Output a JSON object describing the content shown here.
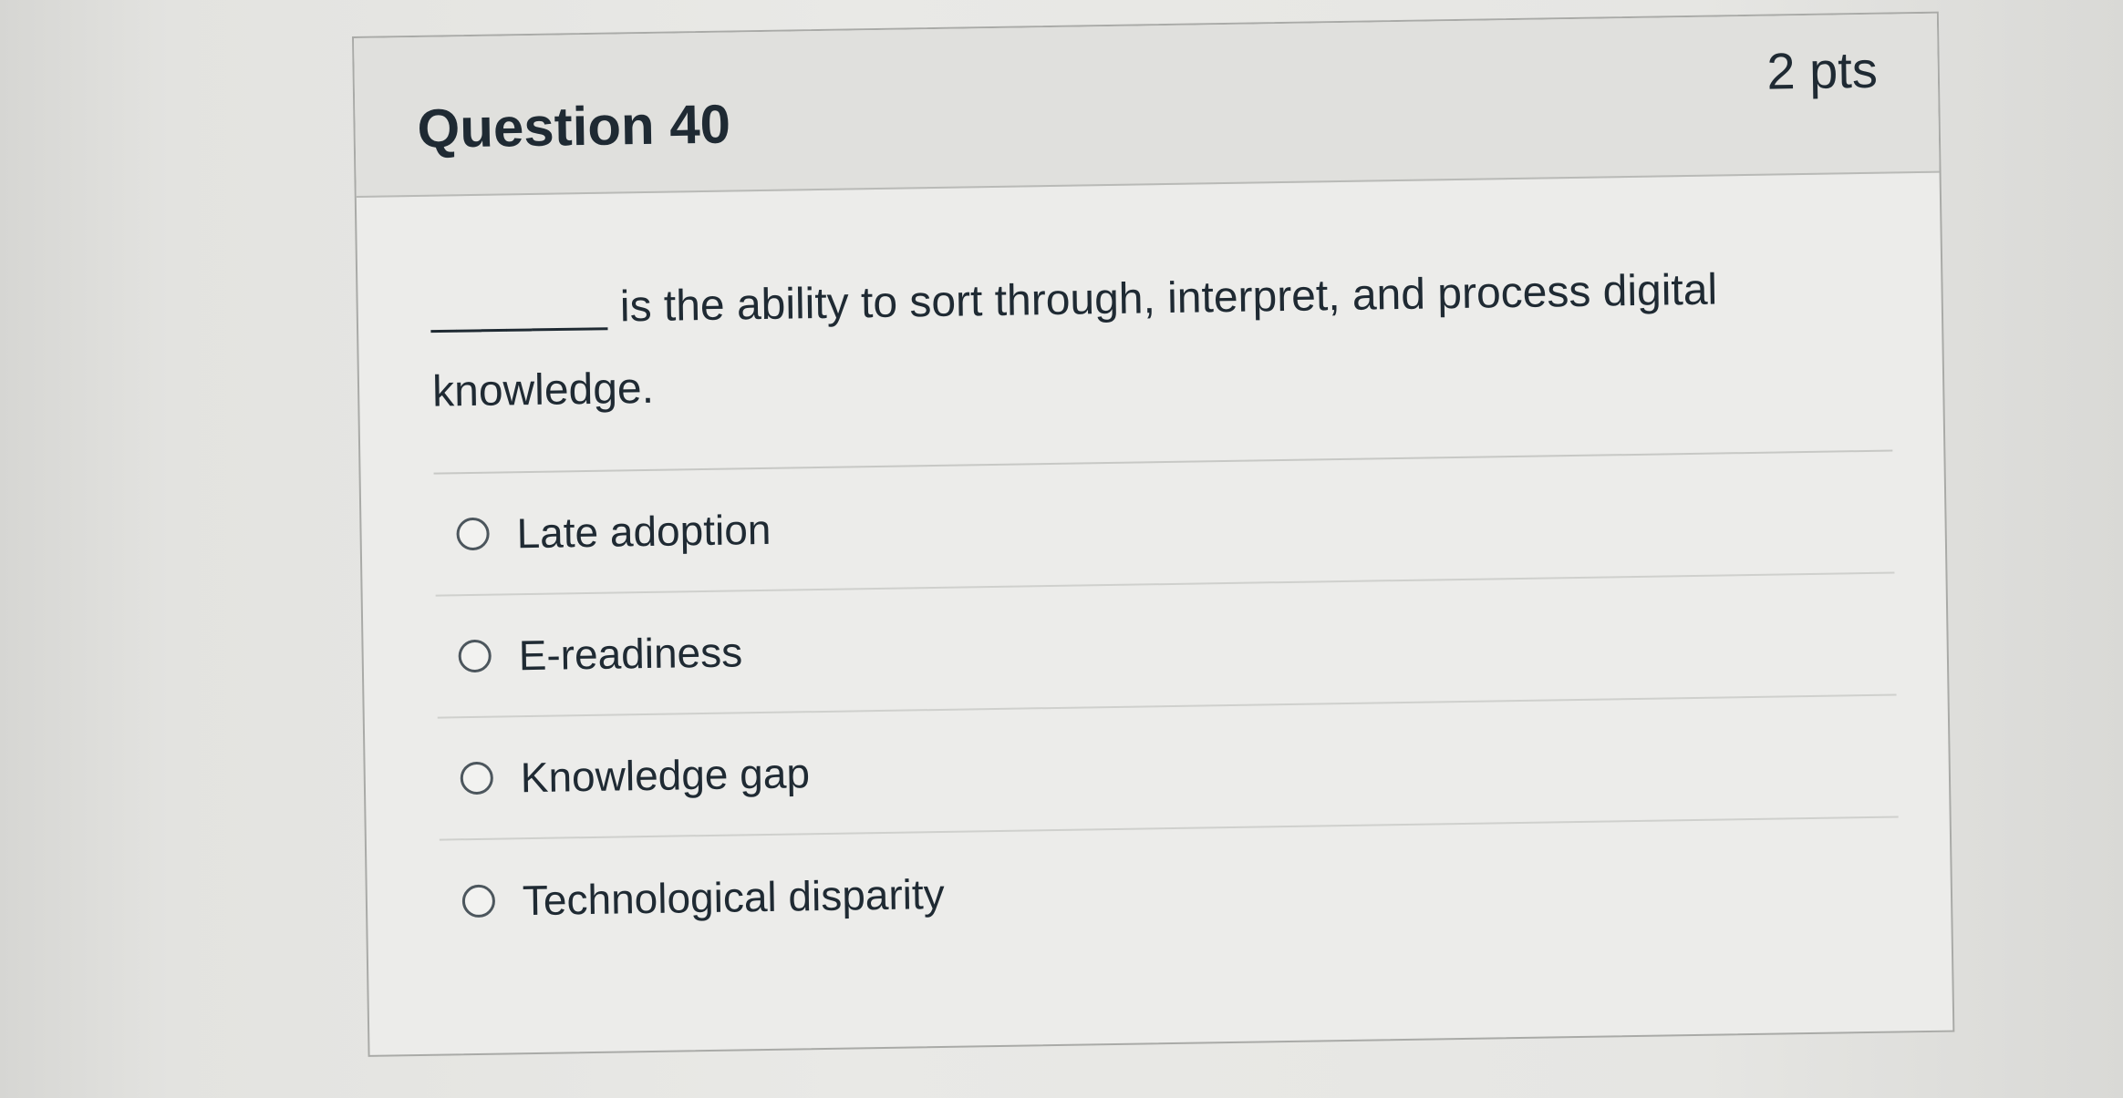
{
  "question": {
    "title": "Question 40",
    "points": "2 pts",
    "blank": "_______",
    "text": " is the ability to sort through, interpret, and process digital knowledge."
  },
  "answers": [
    {
      "label": "Late adoption",
      "selected": false
    },
    {
      "label": "E-readiness",
      "selected": false
    },
    {
      "label": "Knowledge gap",
      "selected": false
    },
    {
      "label": "Technological disparity",
      "selected": false
    }
  ]
}
